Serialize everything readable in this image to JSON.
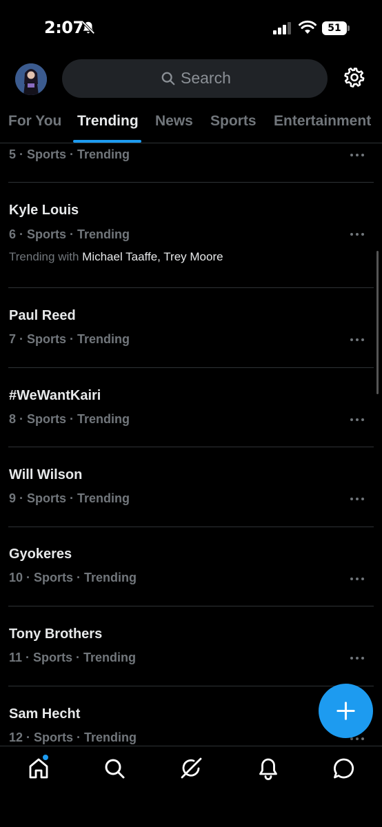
{
  "status_bar": {
    "time": "2:07",
    "battery": "51"
  },
  "header": {
    "search_placeholder": "Search"
  },
  "tabs": [
    {
      "label": "For You",
      "active": false
    },
    {
      "label": "Trending",
      "active": true
    },
    {
      "label": "News",
      "active": false
    },
    {
      "label": "Sports",
      "active": false
    },
    {
      "label": "Entertainment",
      "active": false
    }
  ],
  "trends": [
    {
      "name": "",
      "meta": "5 · Sports · Trending"
    },
    {
      "name": "Kyle Louis",
      "meta": "6 · Sports · Trending",
      "with_label": "Trending with",
      "with_names": "Michael Taaffe, Trey Moore"
    },
    {
      "name": "Paul Reed",
      "meta": "7 · Sports · Trending"
    },
    {
      "name": "#WeWantKairi",
      "meta": "8 · Sports · Trending"
    },
    {
      "name": "Will Wilson",
      "meta": "9 · Sports · Trending"
    },
    {
      "name": "Gyokeres",
      "meta": "10 · Sports · Trending"
    },
    {
      "name": "Tony Brothers",
      "meta": "11 · Sports · Trending"
    },
    {
      "name": "Sam Hecht",
      "meta": "12 · Sports · Trending"
    }
  ],
  "bottom_nav": [
    {
      "icon": "home-icon",
      "has_badge": true
    },
    {
      "icon": "search-icon"
    },
    {
      "icon": "grok-icon"
    },
    {
      "icon": "bell-icon"
    },
    {
      "icon": "messages-icon"
    }
  ],
  "colors": {
    "accent": "#1d9bf0",
    "background": "#000000",
    "text_primary": "#e7e9ea",
    "text_secondary": "#71767b"
  }
}
